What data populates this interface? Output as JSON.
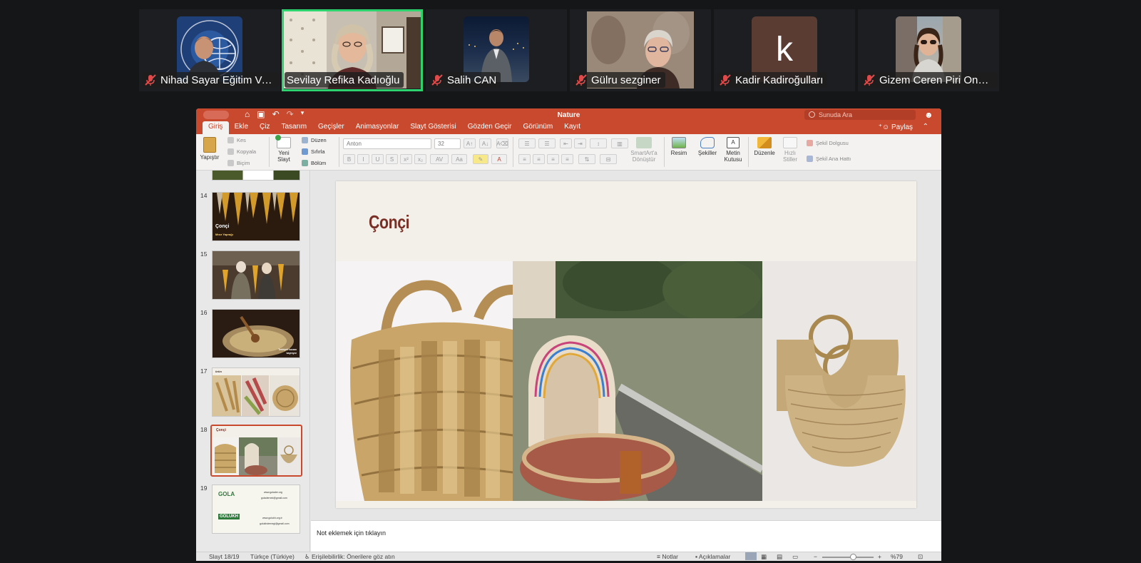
{
  "participants": [
    {
      "name": "Nihad Sayar Eğitim Va..."
    },
    {
      "name": "Sevilay Refika Kadıoğlu",
      "active": true
    },
    {
      "name": "Salih CAN"
    },
    {
      "name": "Gülru sezginer"
    },
    {
      "name": "Kadir Kadiroğulları",
      "avatar_letter": "k"
    },
    {
      "name": "Gizem Ceren Piri Onse..."
    }
  ],
  "ppt": {
    "doc_title": "Nature",
    "search_placeholder": "Sunuda Ara",
    "share_label": "Paylaş",
    "menu_tabs": [
      "Giriş",
      "Ekle",
      "Çiz",
      "Tasarım",
      "Geçişler",
      "Animasyonlar",
      "Slayt Gösterisi",
      "Gözden Geçir",
      "Görünüm",
      "Kayıt"
    ],
    "ribbon": {
      "paste": "Yapıştır",
      "cut": "Kes",
      "copy": "Kopyala",
      "format": "Biçim",
      "new_slide_1": "Yeni",
      "new_slide_2": "Slayt",
      "layout": "Düzen",
      "reset": "Sıfırla",
      "section": "Bölüm",
      "font_name": "Anton",
      "font_size": "32",
      "smartart_1": "SmartArt'a",
      "smartart_2": "Dönüştür",
      "picture": "Resim",
      "shapes": "Şekiller",
      "textbox_1": "Metin",
      "textbox_2": "Kutusu",
      "arrange": "Düzenle",
      "quick_styles_1": "Hızlı",
      "quick_styles_2": "Stiller",
      "shape_fill": "Şekil Dolgusu",
      "shape_outline": "Şekil Ana Hattı"
    },
    "slide_numbers": [
      "14",
      "15",
      "16",
      "17",
      "18",
      "19"
    ],
    "thumb_texts": {
      "t14_title": "Çonçi",
      "t14_sub": "Mısır Yaprağı",
      "t16_caption": "Terbiyeli kazanı kaynıyor",
      "t17_title": "ürün",
      "t18_title": "Çonçi",
      "t19_logo1": "GOLA",
      "t19_logo2": "GOLUKH",
      "t19_link1": "www.golader.org",
      "t19_mail1": "goladernek@gmail.com",
      "t19_link2": "www.golukh.org.tr",
      "t19_mail2": "golukhdernegi@gmail.com"
    },
    "slide_title": "Çonçi",
    "notes_placeholder": "Not eklemek için tıklayın",
    "status": {
      "slide_count": "Slayt 18/19",
      "language": "Türkçe (Türkiye)",
      "accessibility": "Erişilebilirlik: Önerilere göz atın",
      "notes": "Notlar",
      "comments": "Açıklamalar",
      "zoom": "%79",
      "zoom_fraction": 0.6
    }
  }
}
